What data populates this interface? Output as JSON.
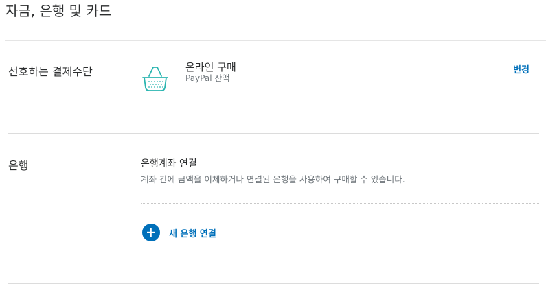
{
  "page": {
    "title": "자금, 은행 및 카드"
  },
  "preferred_payment": {
    "label": "선호하는 결제수단",
    "icon": "shopping-basket-icon",
    "method_title": "온라인 구매",
    "method_subtitle": "PayPal 잔액",
    "change_label": "변경"
  },
  "banks": {
    "label": "은행",
    "title": "은행계좌 연결",
    "description": "계좌 간에 금액을 이체하거나 연결된 은행을 사용하여 구매할 수 있습니다.",
    "add_label": "새 은행 연결",
    "add_icon": "plus-circle-icon"
  },
  "colors": {
    "accent": "#0070ba",
    "icon_teal": "#2ab5b0",
    "muted_text": "#6c7378"
  }
}
